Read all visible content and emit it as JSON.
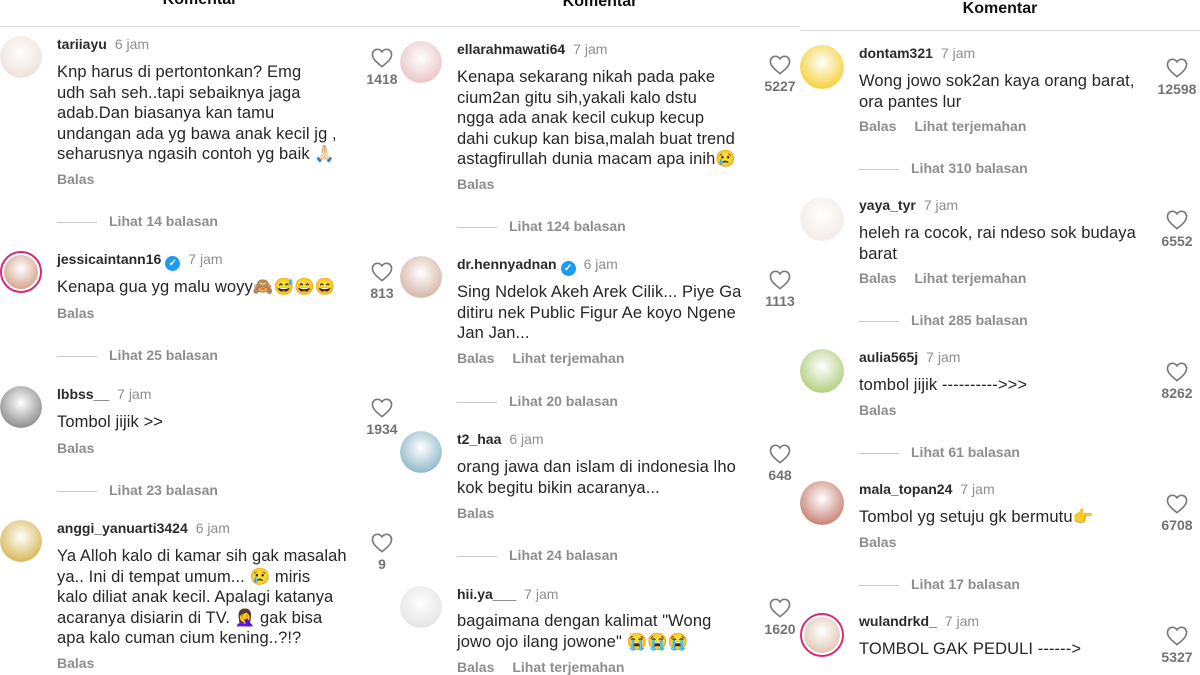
{
  "panels": [
    {
      "header": "Komentar",
      "comments": [
        {
          "username": "tariiayu",
          "verified": false,
          "time": "6 jam",
          "text": "Knp harus di pertontonkan? Emg\nudh sah seh..tapi sebaiknya jaga\nadab.Dan biasanya kan tamu\nundangan ada yg bawa anak kecil jg ,\nseharusnya ngasih contoh yg baik 🙏🏻",
          "reply_label": "Balas",
          "translate_label": "",
          "likes": "1418",
          "view_replies": "Lihat 14 balasan",
          "avatar_color": "#e8d9cf"
        },
        {
          "username": "jessicaintann16",
          "verified": true,
          "time": "7 jam",
          "text": "Kenapa gua yg malu woyy🙈😅😄😄",
          "reply_label": "Balas",
          "translate_label": "",
          "likes": "813",
          "view_replies": "Lihat 25 balasan",
          "avatar_color": "#c98a6a"
        },
        {
          "username": "lbbss__",
          "verified": false,
          "time": "7 jam",
          "text": "Tombol jijik >>",
          "reply_label": "Balas",
          "translate_label": "",
          "likes": "1934",
          "view_replies": "Lihat 23 balasan",
          "avatar_color": "#6b6b6b"
        },
        {
          "username": "anggi_yanuarti3424",
          "verified": false,
          "time": "6 jam",
          "text": "Ya Alloh kalo di kamar sih gak masalah\nya.. Ini di tempat umum... 😢 miris\nkalo diliat anak kecil. Apalagi katanya\nacaranya disiarin di TV. 🤦‍♀️ gak bisa\napa kalo cuman cium kening..?!?",
          "reply_label": "Balas",
          "translate_label": "",
          "likes": "9",
          "view_replies": "",
          "avatar_color": "#c9a227"
        }
      ]
    },
    {
      "header": "Komentar",
      "comments": [
        {
          "username": "ellarahmawati64",
          "verified": false,
          "time": "7 jam",
          "text": "Kenapa sekarang nikah pada pake\ncium2an gitu sih,yakali kalo dstu\nngga ada anak kecil cukup kecup\ndahi cukup kan bisa,malah buat trend\nastagfirullah dunia macam apa inih😢",
          "reply_label": "Balas",
          "translate_label": "",
          "likes": "5227",
          "view_replies": "Lihat 124 balasan",
          "avatar_color": "#e3b4b4"
        },
        {
          "username": "dr.hennyadnan",
          "verified": true,
          "time": "6 jam",
          "text": "Sing Ndelok Akeh Arek Cilik... Piye Ga\nditiru nek Public Figur Ae koyo Ngene\nJan Jan...",
          "reply_label": "Balas",
          "translate_label": "Lihat terjemahan",
          "likes": "1113",
          "view_replies": "Lihat 20 balasan",
          "avatar_color": "#caa08c"
        },
        {
          "username": "t2_haa",
          "verified": false,
          "time": "6 jam",
          "text": "orang jawa dan islam di indonesia lho\nkok begitu bikin acaranya...",
          "reply_label": "Balas",
          "translate_label": "",
          "likes": "648",
          "view_replies": "Lihat 24 balasan",
          "avatar_color": "#6fa3b8"
        },
        {
          "username": "hii.ya___",
          "verified": false,
          "time": "7 jam",
          "text": "bagaimana dengan kalimat \"Wong\njowo ojo ilang jowone\" 😭😭😭",
          "reply_label": "Balas",
          "translate_label": "Lihat terjemahan",
          "likes": "1620",
          "view_replies": "",
          "avatar_color": "#dcdcdc"
        }
      ]
    },
    {
      "header": "Komentar",
      "comments": [
        {
          "username": "dontam321",
          "verified": false,
          "time": "7 jam",
          "text": "Wong jowo sok2an kaya orang barat,\nora pantes lur",
          "reply_label": "Balas",
          "translate_label": "Lihat terjemahan",
          "likes": "12598",
          "view_replies": "Lihat 310 balasan",
          "avatar_color": "#f2c200"
        },
        {
          "username": "yaya_tyr",
          "verified": false,
          "time": "7 jam",
          "text": "heleh ra cocok, rai ndeso sok budaya\nbarat",
          "reply_label": "Balas",
          "translate_label": "Lihat terjemahan",
          "likes": "6552",
          "view_replies": "Lihat 285 balasan",
          "avatar_color": "#f0e6e0"
        },
        {
          "username": "aulia565j",
          "verified": false,
          "time": "7 jam",
          "text": "tombol jijik ---------->>>",
          "reply_label": "Balas",
          "translate_label": "",
          "likes": "8262",
          "view_replies": "Lihat 61 balasan",
          "avatar_color": "#9cbf5a"
        },
        {
          "username": "mala_topan24",
          "verified": false,
          "time": "7 jam",
          "text": "Tombol yg setuju gk bermutu👉",
          "reply_label": "Balas",
          "translate_label": "",
          "likes": "6708",
          "view_replies": "Lihat 17 balasan",
          "avatar_color": "#b85c4a"
        },
        {
          "username": "wulandrkd_",
          "verified": false,
          "time": "7 jam",
          "text": "TOMBOL GAK PEDULI ------>",
          "reply_label": "",
          "translate_label": "",
          "likes": "5327",
          "view_replies": "",
          "avatar_color": "#d6b8a0"
        }
      ]
    }
  ]
}
